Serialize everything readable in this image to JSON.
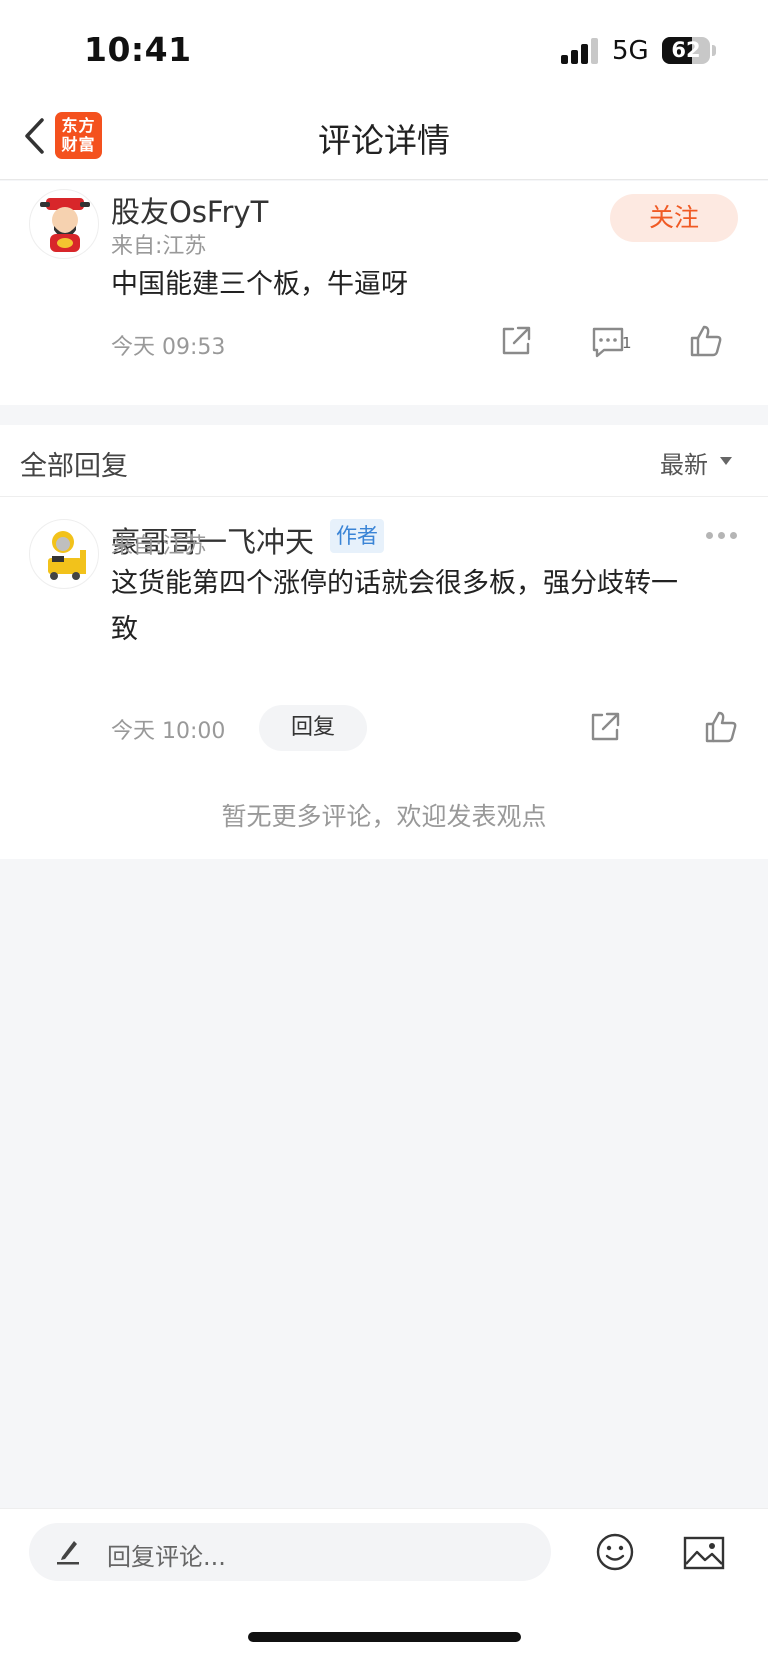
{
  "status_bar": {
    "time": "10:41",
    "network": "5G",
    "battery": "62"
  },
  "nav": {
    "logo_line1": "东方",
    "logo_line2": "财富",
    "title": "评论详情"
  },
  "main_comment": {
    "user": "股友OsFryT",
    "origin": "来自:江苏",
    "text": "中国能建三个板，牛逼呀",
    "time": "今天 09:53",
    "follow_label": "关注",
    "comment_count": "1"
  },
  "replies": {
    "header": "全部回复",
    "sort_label": "最新",
    "items": [
      {
        "user": "豪哥哥一飞冲天",
        "tag": "作者",
        "origin": "来自:江苏",
        "text_line1": "这货能第四个涨停的话就会很多板，强分歧转一",
        "text_line2": "致",
        "time": "今天 10:00",
        "reply_label": "回复"
      }
    ],
    "no_more": "暂无更多评论，欢迎发表观点"
  },
  "bottom_bar": {
    "placeholder": "回复评论..."
  },
  "colors": {
    "accent": "#f05a24",
    "author_tag": "#3a84d6",
    "background": "#f5f6f8"
  }
}
